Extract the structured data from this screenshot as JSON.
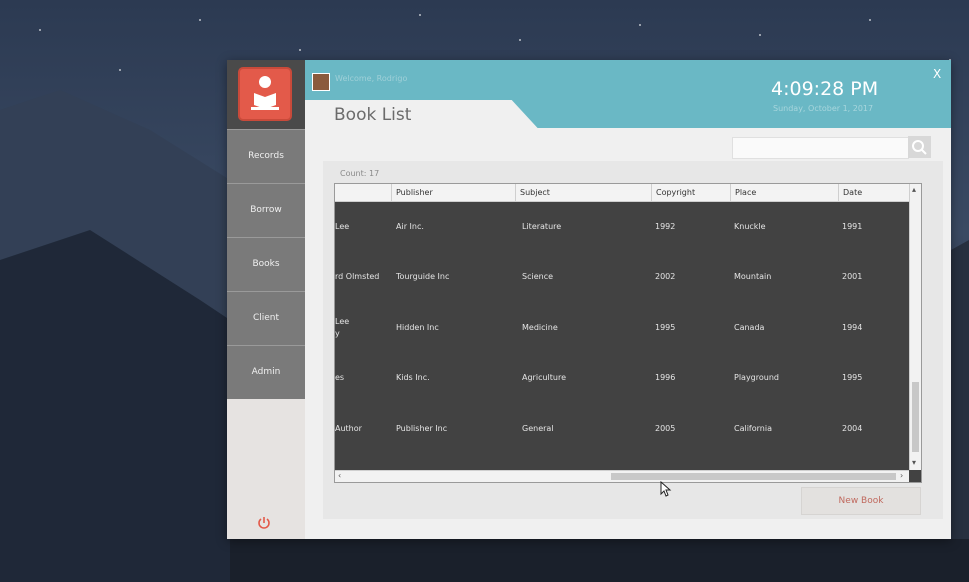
{
  "header": {
    "welcome": "Welcome, Rodrigo",
    "time": "4:09:28 PM",
    "date": "Sunday, October 1, 2017",
    "close_label": "X"
  },
  "page": {
    "title": "Book List"
  },
  "sidebar": {
    "items": [
      {
        "label": "Records"
      },
      {
        "label": "Borrow"
      },
      {
        "label": "Books"
      },
      {
        "label": "Client"
      },
      {
        "label": "Admin"
      }
    ]
  },
  "list": {
    "count_label": "Count: 17",
    "columns": [
      "Publisher",
      "Subject",
      "Copyright",
      "Place",
      "Date"
    ],
    "rows": [
      {
        "author": "Lee",
        "author2": "",
        "publisher": "Air Inc.",
        "subject": "Literature",
        "copyright": "1992",
        "place": "Knuckle",
        "date": "1991"
      },
      {
        "author": "rd Olmsted",
        "author2": "",
        "publisher": "Tourguide Inc",
        "subject": "Science",
        "copyright": "2002",
        "place": "Mountain",
        "date": "2001"
      },
      {
        "author": "Lee",
        "author2": "y",
        "publisher": "Hidden Inc",
        "subject": "Medicine",
        "copyright": "1995",
        "place": "Canada",
        "date": "1994"
      },
      {
        "author": "es",
        "author2": "",
        "publisher": "Kids Inc.",
        "subject": "Agriculture",
        "copyright": "1996",
        "place": "Playground",
        "date": "1995"
      },
      {
        "author": "Author",
        "author2": "",
        "publisher": "Publisher Inc",
        "subject": "General",
        "copyright": "2005",
        "place": "California",
        "date": "2004"
      }
    ]
  },
  "actions": {
    "new_book_label": "New Book"
  },
  "icons": {
    "search": "search-icon",
    "power": "power-icon",
    "logo": "reader-logo-icon"
  },
  "colors": {
    "accent": "#6ab8c5",
    "brand": "#e35a4a",
    "grid_bg": "#424242"
  }
}
